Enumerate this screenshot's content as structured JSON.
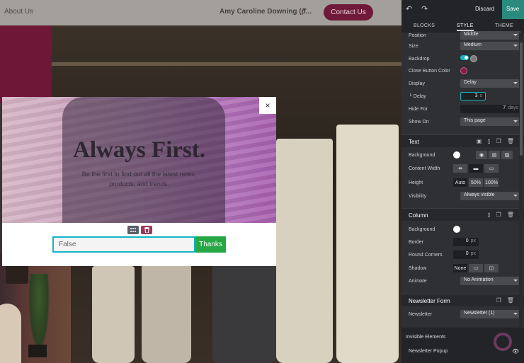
{
  "site": {
    "nav_link": "About Us",
    "user_name": "Amy Caroline Downing (p...",
    "cta_label": "Contact Us",
    "brand_color": "#6f1a38"
  },
  "popup": {
    "title": "Always First.",
    "subtitle": "Be the first to find out all the latest news, products, and trends.",
    "close_glyph": "×",
    "input_value": "False",
    "button_label": "Thanks",
    "button_color": "#28a745"
  },
  "panel": {
    "discard_label": "Discard",
    "save_label": "Save",
    "tabs": [
      {
        "label": "BLOCKS"
      },
      {
        "label": "STYLE"
      },
      {
        "label": "THEME"
      }
    ],
    "popup_options": {
      "position_label": "Position",
      "position_value": "Middle",
      "size_label": "Size",
      "size_value": "Medium",
      "backdrop_label": "Backdrop",
      "close_color_label": "Close Button Color",
      "display_label": "Display",
      "display_value": "Delay",
      "delay_label": "└ Delay",
      "delay_value": "3",
      "delay_unit": "s",
      "hide_for_label": "Hide For",
      "hide_for_value": "7",
      "hide_for_unit": "days",
      "show_on_label": "Show On",
      "show_on_value": "This page"
    },
    "text_section": {
      "title": "Text",
      "background_label": "Background",
      "content_width_label": "Content Width",
      "height_label": "Height",
      "height_options": [
        "Auto",
        "50%",
        "100%"
      ],
      "visibility_label": "Visibility",
      "visibility_value": "Always visible"
    },
    "column_section": {
      "title": "Column",
      "background_label": "Background",
      "border_label": "Border",
      "border_value": "0",
      "border_unit": "px",
      "corners_label": "Round Corners",
      "corners_value": "0",
      "corners_unit": "px",
      "shadow_label": "Shadow",
      "shadow_value": "None",
      "animate_label": "Animate",
      "animate_value": "No Animation"
    },
    "newsletter_section": {
      "title": "Newsletter Form",
      "newsletter_label": "Newsletter",
      "newsletter_value": "Newsletter (1)"
    },
    "invisible": {
      "title": "Invisible Elements",
      "item_label": "Newsletter Popup"
    },
    "colors": {
      "accent": "#14b4c8",
      "save": "#2a8a7e",
      "close_button_color": "#8a1a4a"
    }
  }
}
